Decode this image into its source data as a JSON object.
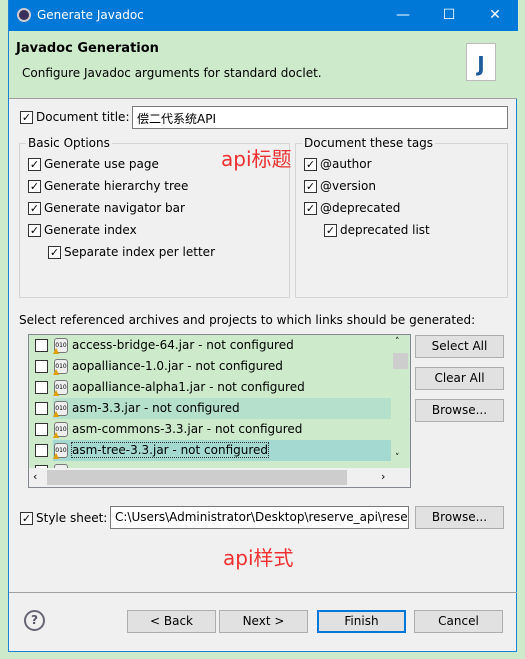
{
  "window": {
    "title": "Generate Javadoc",
    "minimize": "—",
    "maximize": "☐",
    "close": "✕"
  },
  "header": {
    "title": "Javadoc Generation",
    "subtitle": "Configure Javadoc arguments for standard doclet."
  },
  "doc_title": {
    "label": "Document title:",
    "checked": true,
    "value": "偿二代系统API"
  },
  "basic_options": {
    "title": "Basic Options",
    "items": [
      {
        "label": "Generate use page",
        "checked": true
      },
      {
        "label": "Generate hierarchy tree",
        "checked": true
      },
      {
        "label": "Generate navigator bar",
        "checked": true
      },
      {
        "label": "Generate index",
        "checked": true
      },
      {
        "label": "Separate index per letter",
        "checked": true
      }
    ]
  },
  "tags": {
    "title": "Document these tags",
    "items": [
      {
        "label": "@author",
        "checked": true
      },
      {
        "label": "@version",
        "checked": true
      },
      {
        "label": "@deprecated",
        "checked": true
      },
      {
        "label": "deprecated list",
        "checked": true
      }
    ]
  },
  "annotation_title": "api标题",
  "archives": {
    "label": "Select referenced archives and projects to which links should be generated:",
    "items": [
      {
        "label": "access-bridge-64.jar - not configured",
        "checked": false
      },
      {
        "label": "aopalliance-1.0.jar - not configured",
        "checked": false
      },
      {
        "label": "aopalliance-alpha1.jar - not configured",
        "checked": false
      },
      {
        "label": "asm-3.3.jar - not configured",
        "checked": false
      },
      {
        "label": "asm-commons-3.3.jar - not configured",
        "checked": false
      },
      {
        "label": "asm-tree-3.3.jar - not configured",
        "checked": false
      }
    ],
    "select_all": "Select All",
    "clear_all": "Clear All",
    "browse": "Browse..."
  },
  "style_sheet": {
    "label": "Style sheet:",
    "checked": true,
    "value": "C:\\Users\\Administrator\\Desktop\\reserve_api\\reser",
    "browse": "Browse..."
  },
  "annotation_style": "api样式",
  "footer": {
    "back": "< Back",
    "next": "Next >",
    "finish": "Finish",
    "cancel": "Cancel",
    "help": "?"
  },
  "colors": {
    "titlebar": "#0078d7",
    "header_bg": "#cdeacb",
    "annotation": "#f03030"
  }
}
